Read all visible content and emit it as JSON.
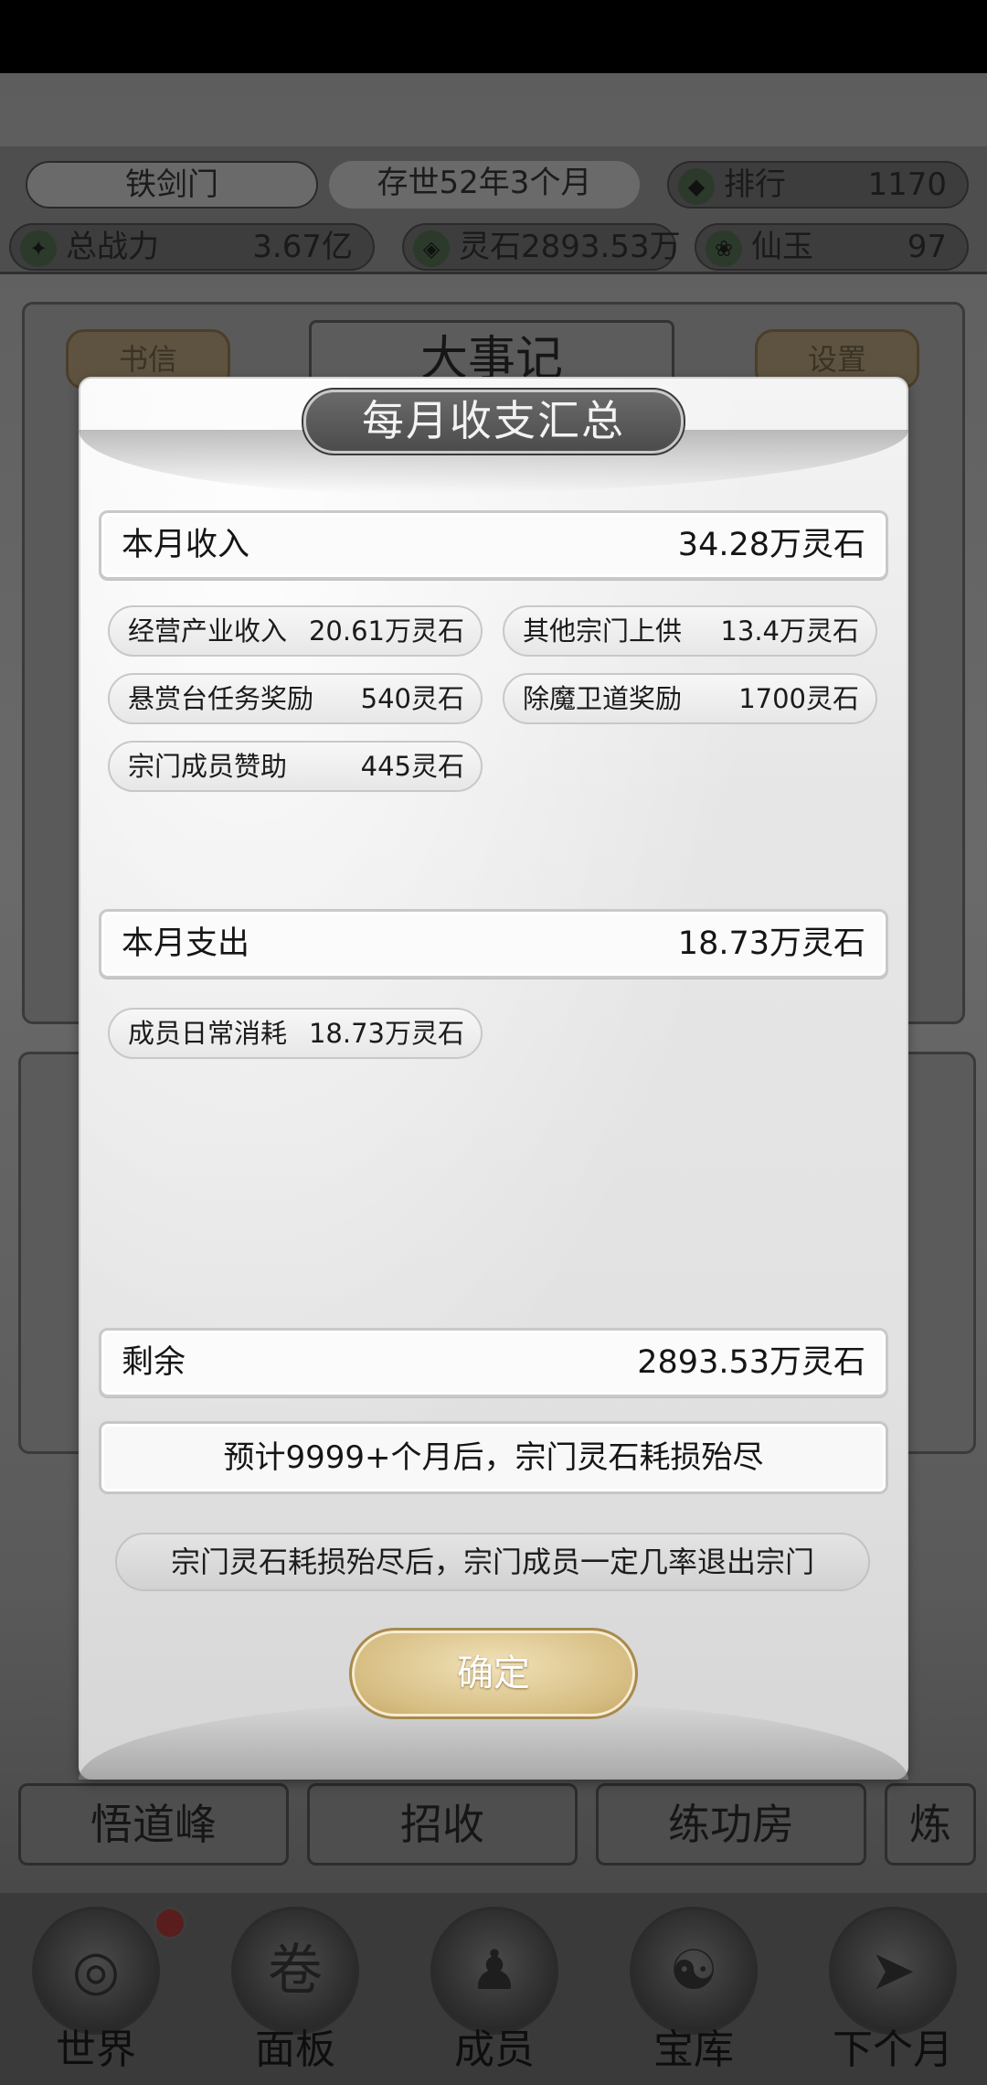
{
  "header": {
    "sect_name": "铁剑门",
    "sect_age": "存世52年3个月",
    "rank_label": "排行",
    "rank_value": "1170",
    "power_label": "总战力",
    "power_value": "3.67亿",
    "spirit_stone_label": "灵石",
    "spirit_stone_value": "2893.53万",
    "jade_label": "仙玉",
    "jade_value": "97"
  },
  "hall": {
    "title": "大事记",
    "letters_button": "书信",
    "settings_button": "设置"
  },
  "buildings": [
    "悟道峰",
    "招收",
    "练功房",
    "炼"
  ],
  "bottom_nav": [
    "世界",
    "面板",
    "成员",
    "宝库",
    "下个月"
  ],
  "modal": {
    "title": "每月收支汇总",
    "income": {
      "label": "本月收入",
      "total": "34.28万灵石",
      "items": [
        {
          "label": "经营产业收入",
          "value": "20.61万灵石"
        },
        {
          "label": "其他宗门上供",
          "value": "13.4万灵石"
        },
        {
          "label": "悬赏台任务奖励",
          "value": "540灵石"
        },
        {
          "label": "除魔卫道奖励",
          "value": "1700灵石"
        },
        {
          "label": "宗门成员赞助",
          "value": "445灵石"
        }
      ]
    },
    "expense": {
      "label": "本月支出",
      "total": "18.73万灵石",
      "items": [
        {
          "label": "成员日常消耗",
          "value": "18.73万灵石"
        }
      ]
    },
    "remaining": {
      "label": "剩余",
      "value": "2893.53万灵石"
    },
    "forecast": "预计9999+个月后，宗门灵石耗损殆尽",
    "warning": "宗门灵石耗损殆尽后，宗门成员一定几率退出宗门",
    "confirm_button": "确定"
  }
}
